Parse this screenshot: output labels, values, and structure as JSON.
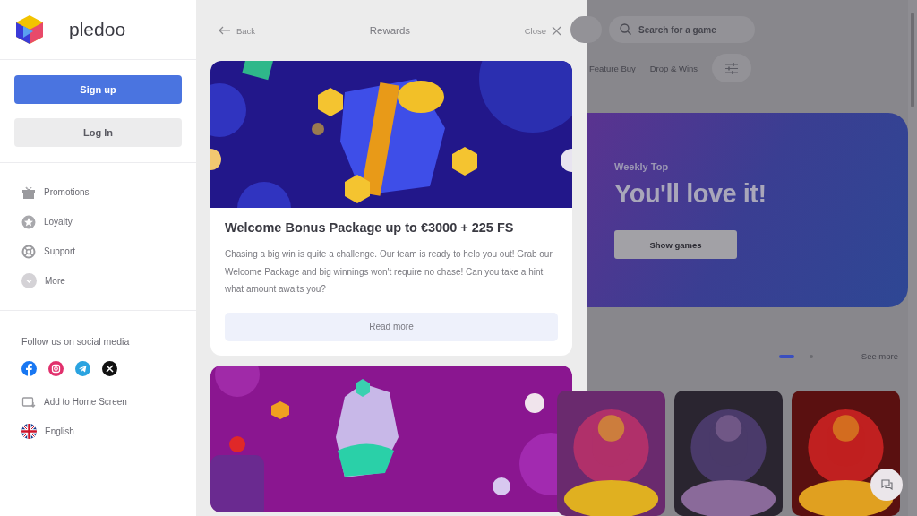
{
  "sidebar": {
    "logo": "pledoo",
    "signup": "Sign up",
    "login": "Log In",
    "nav": [
      {
        "label": "Promotions"
      },
      {
        "label": "Loyalty"
      },
      {
        "label": "Support"
      },
      {
        "label": "More"
      }
    ],
    "social_title": "Follow us on social media",
    "add_home": "Add to Home Screen",
    "language": "English"
  },
  "panel": {
    "back": "Back",
    "title": "Rewards",
    "close": "Close",
    "cards": [
      {
        "kind": "gift",
        "title": "Welcome Bonus Package up to €3000 + 225 FS",
        "text": "Chasing a big win is quite a challenge. Our team is ready to help you out! Grab our Welcome Package and big winnings won't require no chase! Can you take a hint what amount awaits you?",
        "button": "Read more"
      },
      {
        "kind": "potion"
      }
    ]
  },
  "background": {
    "search": {
      "placeholder": "Search for a game"
    },
    "filters": [
      "Feature Buy",
      "Drop & Wins"
    ],
    "banner": {
      "eyebrow": "Weekly Top",
      "title": "You'll love it!",
      "button": "Show games"
    },
    "carousel_dots": [
      {
        "selected": true
      },
      {
        "selected": false
      }
    ],
    "see_more": "See more",
    "games": [
      {
        "kind": "picture"
      },
      {
        "kind": "picture"
      },
      {
        "kind": "picture"
      }
    ]
  }
}
